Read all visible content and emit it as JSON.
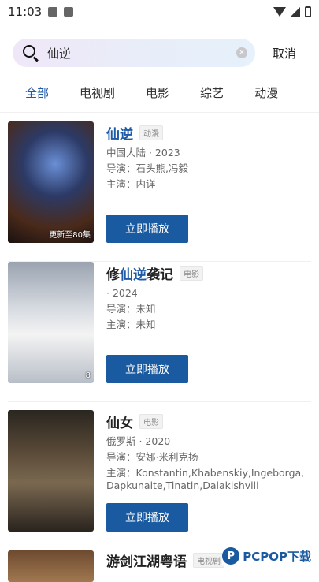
{
  "status_bar": {
    "time": "11:03"
  },
  "search": {
    "query": "仙逆",
    "cancel_label": "取消",
    "clear_glyph": "×"
  },
  "tabs": [
    {
      "label": "全部",
      "active": true
    },
    {
      "label": "电视剧",
      "active": false
    },
    {
      "label": "电影",
      "active": false
    },
    {
      "label": "综艺",
      "active": false
    },
    {
      "label": "动漫",
      "active": false
    }
  ],
  "results": [
    {
      "title_pre": "",
      "title_hl": "仙逆",
      "title_post": "",
      "tag": "动漫",
      "region_year": "中国大陆 · 2023",
      "director": "导演：石头熊,冯毅",
      "cast": "主演：内详",
      "poster_badge": "更新至80集",
      "play_label": "立即播放"
    },
    {
      "title_pre": "修",
      "title_hl": "仙逆",
      "title_post": "袭记",
      "tag": "电影",
      "region_year": "· 2024",
      "director": "导演：未知",
      "cast": "主演：未知",
      "poster_badge": "8",
      "play_label": "立即播放"
    },
    {
      "title_pre": "仙女",
      "title_hl": "",
      "title_post": "",
      "tag": "电影",
      "region_year": "俄罗斯 · 2020",
      "director": "导演：安娜·米利克扬",
      "cast": "主演：Konstantin,Khabenskiy,Ingeborga,Dapkunaite,Tinatin,Dalakishvili",
      "poster_badge": "",
      "play_label": "立即播放"
    },
    {
      "title_pre": "游剑江湖粤语",
      "title_hl": "",
      "title_post": "",
      "tag": "电视剧",
      "region_year": "",
      "director": "",
      "cast": "",
      "poster_badge": "",
      "play_label": ""
    }
  ],
  "watermark": {
    "text": "PCPOP下载",
    "logo": "P"
  }
}
